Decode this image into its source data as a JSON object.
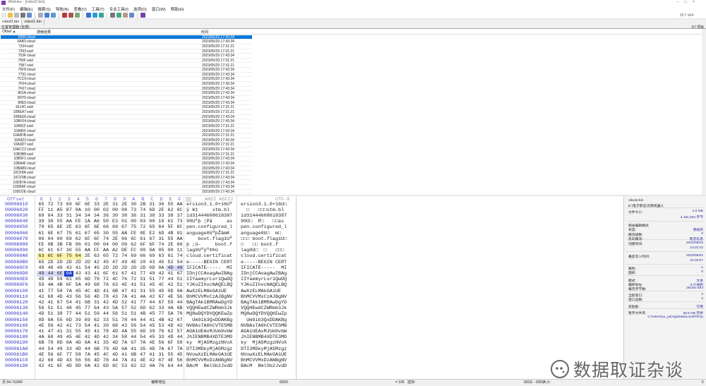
{
  "window": {
    "title": "WinHex - [robot2.bin]",
    "version": "20.7 x64"
  },
  "menu": [
    "文件(F)",
    "编辑(E)",
    "搜索(S)",
    "导航(N)",
    "查看(V)",
    "工具(T)",
    "专业工具(I)",
    "选项(O)",
    "窗口(W)",
    "帮助(H)"
  ],
  "toolbar_icons": [
    "new-icon",
    "open-icon",
    "save-icon",
    "print-icon",
    "properties-icon",
    "undo-icon",
    "copy-icon",
    "paste-icon",
    "find-icon",
    "find-hex-icon",
    "replace-icon",
    "goto-icon",
    "back-icon",
    "forward-icon",
    "disk-icon",
    "ram-icon",
    "calculator-icon",
    "search-icon",
    "settings-icon"
  ],
  "tabs": [
    {
      "label": "robot2.bin",
      "active": true
    },
    {
      "label": "robot1.bin",
      "active": false
    }
  ],
  "location_manager": {
    "title": "位置管理器 (全部)",
    "count": "67 项目",
    "columns": [
      "Offset ▲",
      "搜索结果",
      "时间"
    ],
    "rows": [
      [
        "6060",
        "cloud",
        "2023/05/29  17:43:34"
      ],
      [
        "6A8D",
        "cloud",
        "2023/05/29  17:43:34"
      ],
      [
        "7234",
        "ssid",
        "2023/05/29  17:31:21"
      ],
      [
        "7293",
        "ssid",
        "2023/05/29  17:31:21"
      ],
      [
        "753F",
        "cloud",
        "2023/05/29  17:43:34"
      ],
      [
        "755F",
        "ssid",
        "2023/05/29  17:31:21"
      ],
      [
        "7587",
        "ssid",
        "2023/05/29  17:31:21"
      ],
      [
        "76F8",
        "cloud",
        "2023/05/29  17:43:34"
      ],
      [
        "7791",
        "cloud",
        "2023/05/29  17:43:34"
      ],
      [
        "7CC9",
        "cloud",
        "2023/05/29  17:43:34"
      ],
      [
        "7F54",
        "cloud",
        "2023/05/29  17:43:34"
      ],
      [
        "7F67",
        "cloud",
        "2023/05/29  17:43:34"
      ],
      [
        "801A",
        "cloud",
        "2023/05/29  17:43:34"
      ],
      [
        "807D",
        "cloud",
        "2023/05/29  17:43:34"
      ],
      [
        "80E0",
        "cloud",
        "2023/05/29  17:43:34"
      ],
      [
        "1E14C",
        "ssid",
        "2023/05/29  17:31:21"
      ],
      [
        "10BEA7",
        "ssid",
        "2023/05/29  17:31:21"
      ],
      [
        "10BEE8",
        "cloud",
        "2023/05/29  17:43:34"
      ],
      [
        "10BF04",
        "cloud",
        "2023/05/29  17:43:34"
      ],
      [
        "10A81F",
        "ssid",
        "2023/05/29  17:31:21"
      ],
      [
        "10A86F",
        "cloud",
        "2023/05/29  17:43:34"
      ],
      [
        "10A8DB",
        "ssid",
        "2023/05/29  17:31:21"
      ],
      [
        "10A923",
        "cloud",
        "2023/05/29  17:43:34"
      ],
      [
        "10A9D7",
        "ssid",
        "2023/05/29  17:31:21"
      ],
      [
        "10ACC2",
        "cloud",
        "2023/05/29  17:43:34"
      ],
      [
        "10B3B8",
        "ssid",
        "2023/05/29  17:31:21"
      ],
      [
        "10B5F1",
        "cloud",
        "2023/05/29  17:43:34"
      ],
      [
        "10BA4F",
        "cloud",
        "2023/05/29  17:43:34"
      ],
      [
        "10BA89",
        "cloud",
        "2023/05/29  17:43:34"
      ],
      [
        "10CF8A",
        "ssid",
        "2023/05/29  17:31:21"
      ],
      [
        "10CF9B",
        "cloud",
        "2023/05/29  17:43:34"
      ],
      [
        "10DB7A",
        "cloud",
        "2023/05/29  17:43:34"
      ],
      [
        "10DBAF",
        "cloud",
        "2023/05/29  17:43:34"
      ],
      [
        "10DD2E",
        "cloud",
        "2023/05/29  17:43:34"
      ]
    ]
  },
  "hex": {
    "offset_label": "Offset",
    "cols": [
      "0",
      "1",
      "2",
      "3",
      "4",
      "5",
      "6",
      "7",
      "8",
      "9",
      "A",
      "B",
      "C",
      "D",
      "E",
      "F"
    ],
    "ansi_label": "ANSI ASCII",
    "utf_label": "UTF-8",
    "search_hit": {
      "start": "60A0",
      "end": "60A4"
    },
    "block": {
      "start": "60CE",
      "end": "60D3"
    },
    "cursor": "60D3",
    "rows": [
      [
        "00006010",
        "65 72 73 69 6F 6E 33 2E 31 2E 30 2B 31 36 55 AA",
        "ersion3.1.0+16Uª",
        "ersion3.1.0+16U□"
      ],
      [
        "00006020",
        "FF 11 A5 87 0A 10 00 02 00 08 73 74 6D 2E 62 6C",
        "ÿ ¥‡     stm.bl",
        "  □   □□□stm.bl"
      ],
      [
        "00006030",
        "69 64 33 31 34 34 34 36 30 38 36 31 38 33 38 37",
        "id31444608618387",
        "id31444608618387"
      ],
      [
        "00006040",
        "39 30 55 AA FE 1A A6 50 E3 01 00 03 00 19 61 73",
        "90Uªþ ¦Pã     as",
        "90U□  P□   □□as"
      ],
      [
        "00006050",
        "70 65 6E 2E 63 6F 6E 66 69 67 75 72 65 64 5F 6C",
        "pen.configured_l",
        "pen.configured_l"
      ],
      [
        "00006060",
        "61 6E 67 75 61 67 65 30 55 AA FE 8E E2 6D 4B 01",
        "anguage0UªþŽâmK ",
        "anguage0U□  m□ "
      ],
      [
        "00006070",
        "00 04 00 09 62 6F 6F 74 2E 66 6C 61 67 31 55 AA",
        "    boot.flag1Uª",
        "□□□ boot.flag1U□"
      ],
      [
        "00006080",
        "FE 0B 3B FB 96 01 00 04 00 09 62 6F 6F 74 2E 66",
        "þ ;û–     boot.f",
        "□   □□ boot.f"
      ],
      [
        "00006090",
        "6C 61 67 30 55 AA FF AA A2 DE FC 00 0A 05 00 11",
        "lag0Uªÿª¢Þü     ",
        "lag0U□  □   □□□"
      ],
      [
        "000060A0",
        "63 6C 6F 75 64 2E 63 65 72 74 69 66 69 63 61 74",
        "cloud.certificat",
        "cloud.certificat"
      ],
      [
        "000060B0",
        "65 2D 2D 2D 2D 2D 42 45 47 49 4E 20 43 45 52 54",
        "e-----BEGIN CERT",
        "e-----BEGIN CERT"
      ],
      [
        "000060C0",
        "49 46 49 43 41 54 45 2D 2D 2D 2D 2D 0D 0A 4D 49",
        "IFICATE-----  MI",
        "IFICATE-----  MI"
      ],
      [
        "000060D0",
        "49 44 6E 6A 43 43 41 6F 61 67 41 77 49 42 41 67",
        "IDnjCCAoagAwIBAg",
        "IDnjCCAoagAwIBAg"
      ],
      [
        "000060E0",
        "49 49 59 61 65 6D 79 72 4C 76 72 31 51 77 44 51",
        "IIYaemyrLvr1QwDQ",
        "IIYaemyrLvr1QwDQ"
      ],
      [
        "000060F0",
        "59 4A 4B 6F 5A 49 68 76 63 4E 41 51 45 4C 42 51",
        "YJKoZIhvcNAQELBQ",
        "YJKoZIhvcNAQELBQ"
      ],
      [
        "00006100",
        "41 77 58 7A 45 4C 4D 41 6B 47 41 31 55 45 0D 0A",
        "AwXzELMAkGA1UE  ",
        "AwXzELMAkGA1UE  "
      ],
      [
        "00006110",
        "42 68 4D 43 56 56 4D 78 43 7A 41 4A 42 67 4E 56",
        "BhMCVVMxCzAJBgNV",
        "BhMCVVMxCzAJBgNV"
      ],
      [
        "00006120",
        "42 41 67 54 41 6B 31 42 4D 52 41 77 44 67 59 44",
        "BAgTAk1BMRAwDgYD",
        "BAgTAk1BMRAwDgYD"
      ],
      [
        "00006130",
        "56 51 51 48 45 77 64 43 5A 57 52 6D 62 33 4A 6B",
        "VQQHEwdCZWRmb3Jk",
        "VQQHEwdCZWRmb3Jk"
      ],
      [
        "00006140",
        "4D 51 38 77 44 51 59 44 56 51 51 4B 45 77 5A 70",
        "MQ8wDQYDVQQKEwZp",
        "MQ8wDQYDVQQKEwZp"
      ],
      [
        "00006150",
        "0D 0A 55 6D 39 69 62 33 51 78 44 44 41 4B 42 67",
        "  Um9ib3QxDDAKBg",
        "  Um9ib3QxDDAKBg"
      ],
      [
        "00006160",
        "4E 56 42 41 73 54 41 30 68 43 56 54 45 53 4D 42",
        "NVBAsTA0hCVTESMB",
        "NVBAsTA0hCVTESMB"
      ],
      [
        "00006170",
        "41 47 41 31 55 45 41 78 4D 4A 55 6D 39 76 62 57",
        "AGA1UEAxMJUm9vbW",
        "AGA1UEAxMJUm9vbW"
      ],
      [
        "00006180",
        "4A 68 49 45 4E 42 4D 42 34 58 44 54 45 33 4D 44",
        "JhIENBMB4XDTE3MD",
        "JhIENBMB4XDTE3MD"
      ],
      [
        "00006190",
        "6B 79 0D 0A 4D 6A 41 35 4D 7A 67 7A 4E 56 6F 58",
        "ky  MjA5MzgzNVoX",
        "ky  MjA5MzgzNVoX"
      ],
      [
        "000061A0",
        "44 54 49 33 4D 44 6B 79 4D 6A 41 35 4D 7A 67 7A",
        "DTI3MDkyMjA5Mzgz",
        "DTI3MDkyMjA5Mzgz"
      ],
      [
        "000061B0",
        "4E 56 6F 77 58 7A 45 4C 4D 41 6B 47 41 31 55 45",
        "NVowXzELMAkGA1UE",
        "NVowXzELMAkGA1UE"
      ],
      [
        "000061C0",
        "42 68 4D 43 56 56 4D 78 44 7A 41 4E 42 67 4E 56",
        "BhMCVVMxDzANBgNV",
        "BhMCVVMxDzANBgNV"
      ],
      [
        "000061D0",
        "42 41 6F 4D 0D 0A 42 6D 6C 53 62 32 4A 76 64 44",
        "BAcM  BmlSb2JvdD",
        "BAcM  BmlSb2JvdD"
      ]
    ]
  },
  "info": {
    "filename": "robot2.bin",
    "path": "E:\\电子取证\\云鲸机器人",
    "items": [
      {
        "k": "文件大小:",
        "v": "4.0 MB"
      },
      {
        "k": "",
        "v": "4,194,304 字节"
      },
      {
        "k": "缺省编辑模式",
        "v": ""
      },
      {
        "k": "状态:",
        "v": "原始的"
      },
      {
        "k": "撤消级数:",
        "v": "0"
      },
      {
        "k": "反向撤消:",
        "v": "暂无信息"
      },
      {
        "k": "创建时间:",
        "v": "2023/05/16"
      },
      {
        "k": "",
        "v": "10:22:22"
      },
      {
        "k": "最后写入时间:",
        "v": "2023/05/02"
      },
      {
        "k": "",
        "v": "21:03:57"
      },
      {
        "k": "属性:",
        "v": "A"
      },
      {
        "k": "图标:",
        "v": "0"
      },
      {
        "k": "模式:",
        "v": "文本"
      },
      {
        "k": "偏移地址:",
        "v": "十六进制"
      },
      {
        "k": "每页字节数:",
        "v": "29x16=464"
      },
      {
        "k": "当前窗口:",
        "v": "2"
      },
      {
        "k": "窗口总数:",
        "v": "2"
      },
      {
        "k": "剪贴板:",
        "v": "可用"
      },
      {
        "k": "暂存文件夹:",
        "v": "25.5 GB 空余"
      },
      {
        "k": "",
        "v": "C:\\Users\\yu_ya\\AppData\\Local\\Temp"
      }
    ]
  },
  "status": {
    "page": "页 54 / 8,840",
    "offset_label": "偏移地址:",
    "offset": "60D3",
    "value": "= 106",
    "block_label": "选块:",
    "block": "60CE - 60D3",
    "size_label": "大小:",
    "size": "6"
  },
  "watermark": "数据取证杂谈"
}
